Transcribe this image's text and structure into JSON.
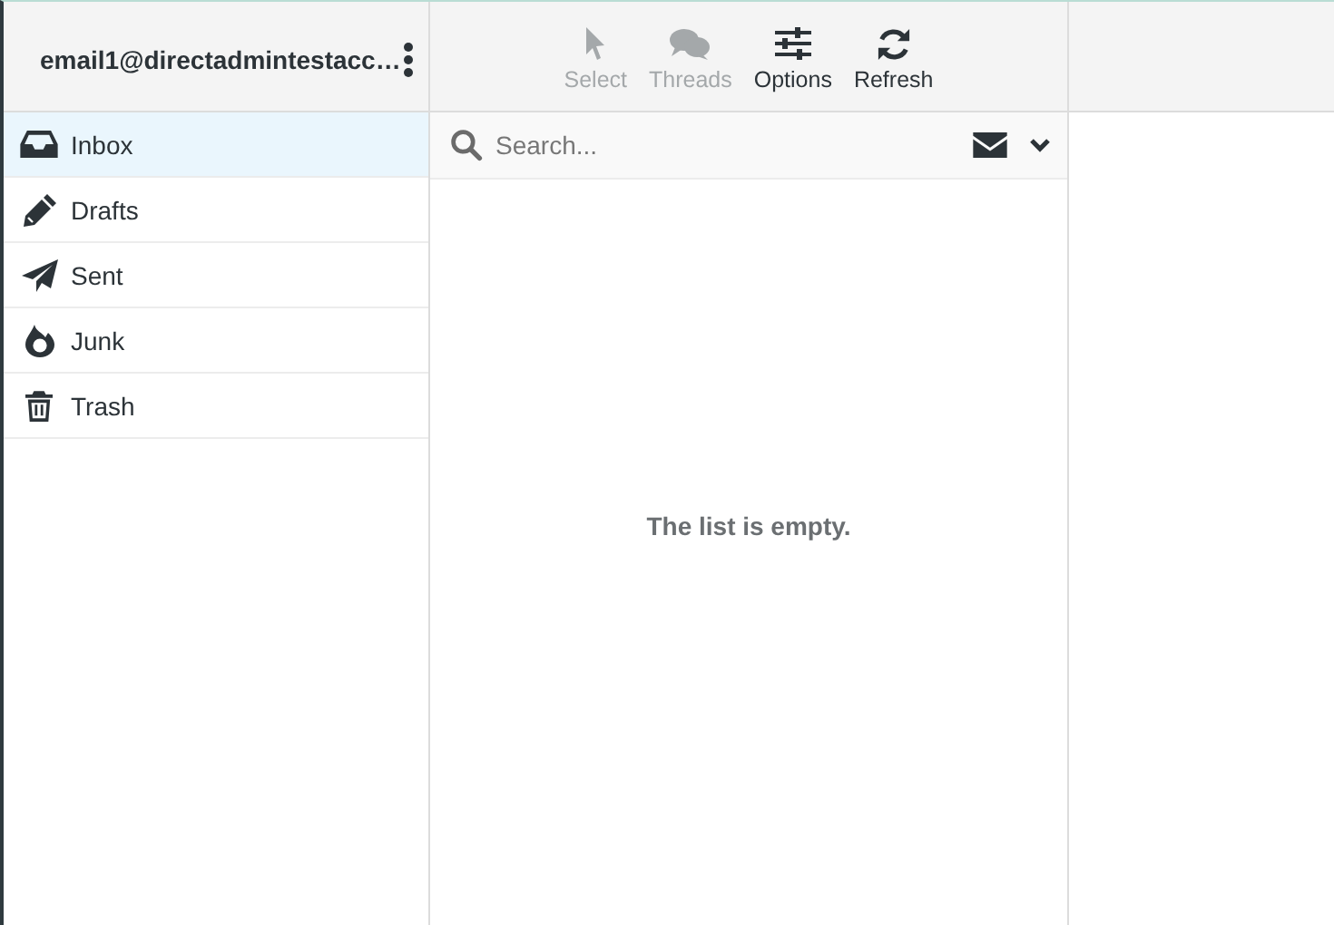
{
  "account": {
    "label": "email1@directadmintestacc…"
  },
  "toolbar": [
    {
      "kind": "select",
      "label": "Select",
      "disabled": true
    },
    {
      "kind": "threads",
      "label": "Threads",
      "disabled": true
    },
    {
      "kind": "options",
      "label": "Options",
      "disabled": false
    },
    {
      "kind": "refresh",
      "label": "Refresh",
      "disabled": false
    }
  ],
  "folders": [
    {
      "kind": "inbox",
      "label": "Inbox",
      "selected": true
    },
    {
      "kind": "drafts",
      "label": "Drafts",
      "selected": false
    },
    {
      "kind": "sent",
      "label": "Sent",
      "selected": false
    },
    {
      "kind": "junk",
      "label": "Junk",
      "selected": false
    },
    {
      "kind": "trash",
      "label": "Trash",
      "selected": false
    }
  ],
  "search": {
    "placeholder": "Search..."
  },
  "message_list": {
    "empty_text": "The list is empty."
  }
}
